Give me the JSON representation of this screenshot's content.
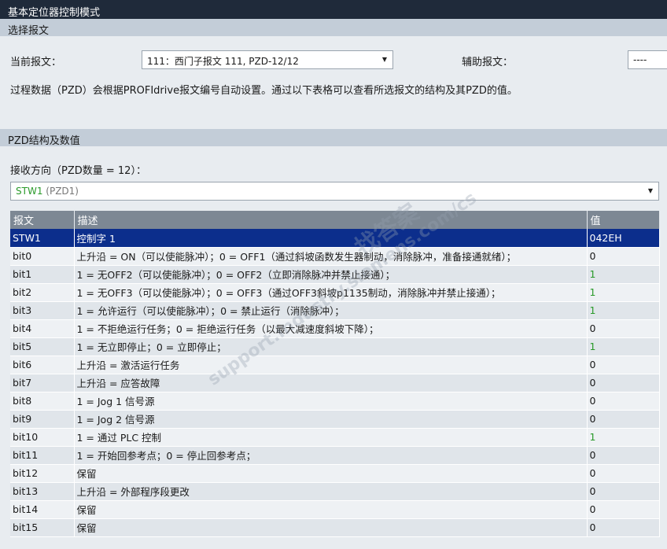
{
  "window": {
    "title": "基本定位器控制模式"
  },
  "telegram_section": {
    "header": "选择报文",
    "current_label": "当前报文：",
    "current_value": "111：西门子报文 111, PZD-12/12",
    "aux_label": "辅助报文：",
    "aux_value": "----",
    "info_text": "过程数据（PZD）会根据PROFIdrive报文编号自动设置。通过以下表格可以查看所选报文的结构及其PZD的值。"
  },
  "pzd_section": {
    "header": "PZD结构及数值",
    "receive_label": "接收方向（PZD数量 = 12）：",
    "selected_word": "STW1",
    "selected_pzd": "(PZD1)"
  },
  "table": {
    "columns": [
      "报文",
      "描述",
      "值"
    ],
    "rows": [
      {
        "name": "STW1",
        "desc": "控制字 1",
        "value": "042EH",
        "selected": true
      },
      {
        "name": "bit0",
        "desc": "上升沿 = ON（可以使能脉冲）；0 = OFF1（通过斜坡函数发生器制动，消除脉冲，准备接通就绪）；",
        "value": "0"
      },
      {
        "name": "bit1",
        "desc": "1 = 无OFF2（可以使能脉冲）；0 = OFF2（立即消除脉冲并禁止接通）；",
        "value": "1",
        "green": true
      },
      {
        "name": "bit2",
        "desc": "1 = 无OFF3（可以使能脉冲）；0 = OFF3（通过OFF3斜坡p1135制动，消除脉冲并禁止接通）；",
        "value": "1",
        "green": true
      },
      {
        "name": "bit3",
        "desc": "1 = 允许运行（可以使能脉冲）；0 = 禁止运行（消除脉冲）；",
        "value": "1",
        "green": true
      },
      {
        "name": "bit4",
        "desc": "1 = 不拒绝运行任务；0 = 拒绝运行任务（以最大减速度斜坡下降）；",
        "value": "0"
      },
      {
        "name": "bit5",
        "desc": "1 = 无立即停止；0 = 立即停止；",
        "value": "1",
        "green": true
      },
      {
        "name": "bit6",
        "desc": "上升沿 = 激活运行任务",
        "value": "0"
      },
      {
        "name": "bit7",
        "desc": "上升沿 = 应答故障",
        "value": "0"
      },
      {
        "name": "bit8",
        "desc": "1 = Jog 1 信号源",
        "value": "0"
      },
      {
        "name": "bit9",
        "desc": "1 = Jog 2 信号源",
        "value": "0"
      },
      {
        "name": "bit10",
        "desc": "1 = 通过 PLC 控制",
        "value": "1",
        "green": true
      },
      {
        "name": "bit11",
        "desc": "1 = 开始回参考点；0 = 停止回参考点；",
        "value": "0"
      },
      {
        "name": "bit12",
        "desc": "保留",
        "value": "0"
      },
      {
        "name": "bit13",
        "desc": "上升沿 = 外部程序段更改",
        "value": "0"
      },
      {
        "name": "bit14",
        "desc": "保留",
        "value": "0"
      },
      {
        "name": "bit15",
        "desc": "保留",
        "value": "0"
      }
    ]
  },
  "watermark": {
    "line1": "找答案",
    "line2": "support.industry.siemens.com/cs"
  },
  "colors": {
    "title_bg": "#1f2a3a",
    "header_bg": "#c3cdd8",
    "table_header_bg": "#7d8894",
    "selected_row_bg": "#0c2e8c",
    "value_on": "#2a9a2a"
  }
}
